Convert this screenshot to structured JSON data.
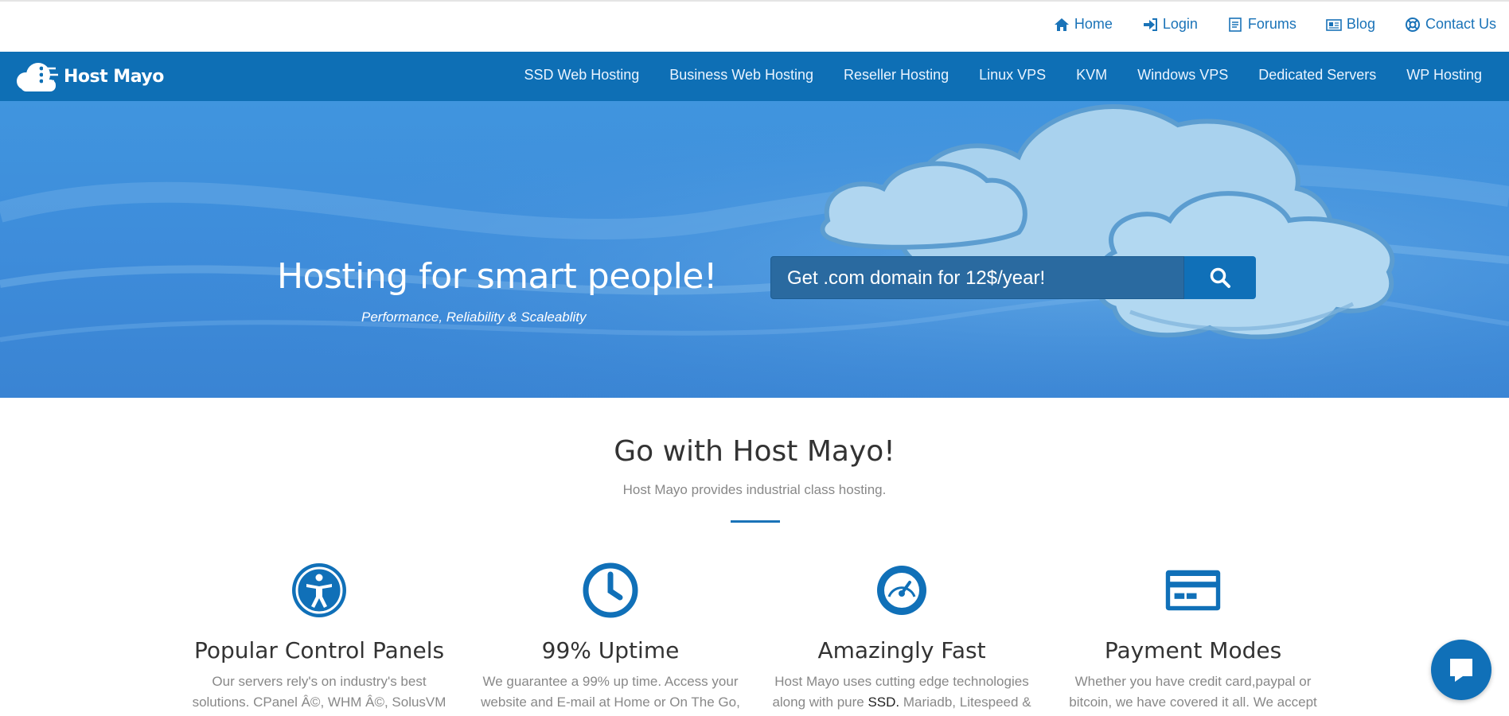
{
  "topbar": {
    "links": [
      {
        "label": "Home",
        "icon": "home-icon"
      },
      {
        "label": "Login",
        "icon": "login-icon"
      },
      {
        "label": "Forums",
        "icon": "forums-icon"
      },
      {
        "label": "Blog",
        "icon": "blog-icon"
      },
      {
        "label": "Contact Us",
        "icon": "lifebuoy-icon"
      }
    ]
  },
  "navbar": {
    "logo_text": "Host Mayo",
    "links": [
      "SSD Web Hosting",
      "Business Web Hosting",
      "Reseller Hosting",
      "Linux VPS",
      "KVM",
      "Windows VPS",
      "Dedicated Servers",
      "WP Hosting"
    ]
  },
  "hero": {
    "title": "Hosting for smart people!",
    "subtitle": "Performance, Reliability & Scaleablity",
    "domain_text": "Get .com domain for 12$/year!"
  },
  "section": {
    "title": "Go with Host Mayo!",
    "subtitle": "Host Mayo provides industrial class hosting."
  },
  "features": [
    {
      "icon": "accessibility-icon",
      "title": "Popular Control Panels",
      "line1": "Our servers rely's on industry's best",
      "line2": "solutions. CPanel Â©, WHM Â©, SolusVM"
    },
    {
      "icon": "clock-icon",
      "title": "99% Uptime",
      "line1": "We guarantee a 99% up time. Access your",
      "line2": "website and E-mail at Home or On The Go,"
    },
    {
      "icon": "speedometer-icon",
      "title": "Amazingly Fast",
      "line1": "Host Mayo uses cutting edge technologies",
      "line2_pre": "along with pure ",
      "line2_bold": "SSD.",
      "line2_post": " Mariadb, Litespeed &"
    },
    {
      "icon": "credit-card-icon",
      "title": "Payment Modes",
      "line1": "Whether you have credit card,paypal or",
      "line2": "bitcoin, we have covered it all. We accept"
    }
  ],
  "colors": {
    "brand": "#0e6fb5",
    "link": "#1a73b8",
    "hero": "#3e8ddb"
  }
}
